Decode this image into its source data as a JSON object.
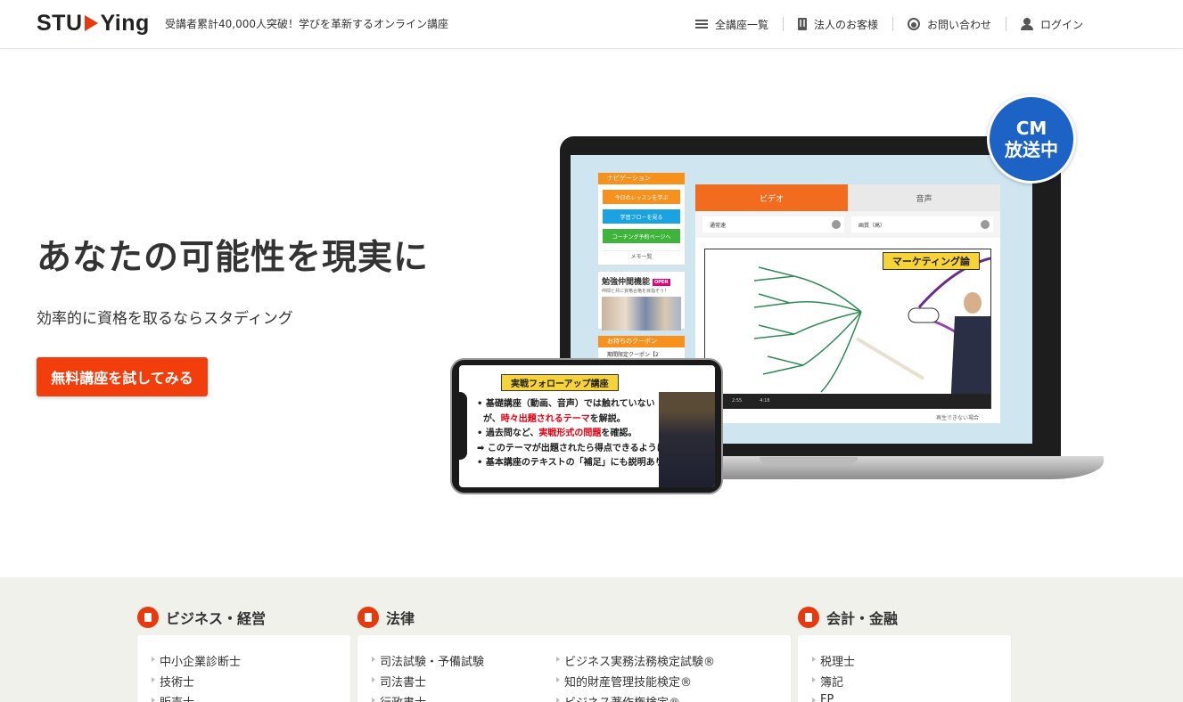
{
  "header": {
    "logo_prefix": "STU",
    "logo_suffix": "Ying",
    "tagline": "受講者累計40,000人突破！学びを革新するオンライン講座",
    "nav": [
      {
        "label": "全講座一覧",
        "icon": "list-icon"
      },
      {
        "label": "法人のお客様",
        "icon": "building-icon"
      },
      {
        "label": "お問い合わせ",
        "icon": "headset-icon"
      },
      {
        "label": "ログイン",
        "icon": "user-icon"
      }
    ]
  },
  "hero": {
    "title": "あなたの可能性を現実に",
    "subtitle": "効率的に資格を取るならスタディング",
    "cta_label": "無料講座を試してみる",
    "cm_badge": {
      "line1": "CM",
      "line2": "放送中"
    }
  },
  "laptop_app": {
    "nav_header": "ナビゲーション",
    "buttons": [
      {
        "label": "今日のレッスンを学ぶ",
        "color": "#f7911e"
      },
      {
        "label": "学習フローを見る",
        "color": "#1aa3e0"
      },
      {
        "label": "コーチング予約ページへ",
        "color": "#3fb33c"
      }
    ],
    "memo_label": "メモ一覧",
    "study_title": "勉強仲間機能",
    "study_badge": "OPEN",
    "study_sub": "仲間と共に資格合格を目指そう！",
    "coupon_header": "お持ちのクーポン",
    "coupon_line": "期間限定クーポン【2",
    "tab_video": "ビデオ",
    "tab_audio": "音声",
    "select_speed": "通常速",
    "select_quality": "画質（高）",
    "video_title": "マーケティング論",
    "time_current": "2:55",
    "time_total": "4:18",
    "help": "再生できない場合"
  },
  "phone_app": {
    "title": "実戦フォローアップ講座",
    "line1": "• 基礎講座（動画、音声）では触れていない",
    "line2a": "が、",
    "line2b": "時々出題されるテーマ",
    "line2c": "を解説。",
    "line3a": "• 過去問など、",
    "line3b": "実戦形式の問題",
    "line3c": "を確認。",
    "line4": "➡ このテーマが出題されたら得点できるように",
    "line5": "• 基本講座のテキストの「補足」にも説明あり。"
  },
  "categories": [
    {
      "title": "ビジネス・経営",
      "items": [
        "中小企業診断士",
        "技術士",
        "販売士"
      ]
    },
    {
      "title": "法律",
      "items": [
        "司法試験・予備試験",
        "司法書士",
        "行政書士"
      ],
      "items2": [
        "ビジネス実務法務検定試験®",
        "知的財産管理技能検定®",
        "ビジネス著作権検定®"
      ]
    },
    {
      "title": "会計・金融",
      "items": [
        "税理士",
        "簿記",
        "FP"
      ]
    }
  ],
  "colors": {
    "accent": "#f23d0c",
    "cm_blue": "#1c63c5",
    "section_bg": "#f1f1ec"
  }
}
